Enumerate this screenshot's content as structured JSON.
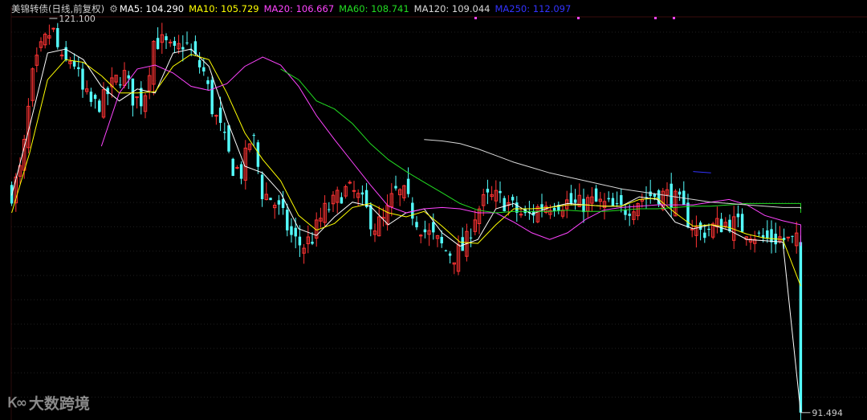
{
  "header": {
    "title": "美锦转债(日线,前复权)",
    "gear_icon": "gear-icon",
    "indicators": [
      {
        "label": "MA5: 104.290",
        "color": "#ffffff"
      },
      {
        "label": "MA10: 105.729",
        "color": "#ffff00"
      },
      {
        "label": "MA20: 106.667",
        "color": "#ff44ff"
      },
      {
        "label": "MA60: 108.741",
        "color": "#22dd22"
      },
      {
        "label": "MA120: 109.044",
        "color": "#d8d8d8"
      },
      {
        "label": "MA250: 112.097",
        "color": "#3333ff"
      }
    ]
  },
  "watermark": {
    "icon": "kuo-logo-icon",
    "text": "大数跨境"
  },
  "chart_data": {
    "type": "candlestick",
    "ylim": [
      91,
      122
    ],
    "x_count": 190,
    "max_label": "121.100",
    "min_label": "91.494",
    "close_path": [
      [
        0,
        108.0
      ],
      [
        6,
        110.0
      ],
      [
        12,
        116.5
      ],
      [
        18,
        119.0
      ],
      [
        24,
        120.3
      ],
      [
        30,
        117.5
      ],
      [
        36,
        118.2
      ],
      [
        42,
        115.5
      ],
      [
        48,
        114.5
      ],
      [
        54,
        114.9
      ],
      [
        60,
        116.2
      ],
      [
        66,
        117.0
      ],
      [
        72,
        115.0
      ],
      [
        78,
        115.0
      ],
      [
        84,
        119.5
      ],
      [
        90,
        119.2
      ],
      [
        96,
        118.4
      ],
      [
        102,
        119.4
      ],
      [
        108,
        118.1
      ],
      [
        114,
        116.9
      ],
      [
        118,
        114.5
      ],
      [
        124,
        112.5
      ],
      [
        130,
        110.0
      ],
      [
        136,
        109.5
      ],
      [
        142,
        112.6
      ],
      [
        148,
        108.0
      ],
      [
        154,
        107.5
      ],
      [
        160,
        106.2
      ],
      [
        166,
        104.5
      ],
      [
        172,
        104.0
      ],
      [
        178,
        104.7
      ],
      [
        184,
        106.5
      ],
      [
        190,
        107.2
      ],
      [
        196,
        108.2
      ],
      [
        202,
        108.0
      ],
      [
        208,
        107.0
      ],
      [
        214,
        105.5
      ],
      [
        220,
        105.9
      ],
      [
        226,
        108.0
      ],
      [
        232,
        107.8
      ],
      [
        238,
        106.2
      ],
      [
        244,
        105.1
      ],
      [
        250,
        104.5
      ],
      [
        256,
        103.7
      ],
      [
        262,
        103.3
      ],
      [
        268,
        104.0
      ],
      [
        274,
        106.5
      ],
      [
        280,
        107.5
      ],
      [
        286,
        107.6
      ],
      [
        292,
        107.3
      ],
      [
        298,
        106.6
      ],
      [
        304,
        106.1
      ],
      [
        310,
        106.8
      ],
      [
        316,
        107.2
      ],
      [
        322,
        107.3
      ],
      [
        328,
        107.3
      ],
      [
        334,
        107.0
      ],
      [
        340,
        107.3
      ],
      [
        346,
        107.2
      ],
      [
        352,
        107.0
      ],
      [
        358,
        106.6
      ],
      [
        364,
        106.9
      ],
      [
        370,
        107.5
      ],
      [
        376,
        107.8
      ],
      [
        382,
        107.9
      ],
      [
        388,
        107.8
      ],
      [
        394,
        107.2
      ],
      [
        400,
        105.9
      ],
      [
        406,
        105.0
      ],
      [
        412,
        105.3
      ],
      [
        418,
        105.6
      ],
      [
        424,
        105.8
      ],
      [
        430,
        105.5
      ],
      [
        436,
        105.2
      ],
      [
        442,
        104.6
      ],
      [
        448,
        104.5
      ],
      [
        454,
        104.6
      ],
      [
        460,
        104.3
      ],
      [
        464,
        104.3
      ],
      [
        466,
        91.494
      ]
    ],
    "ma_lines": [
      {
        "name": "MA5",
        "color": "#ffffff",
        "start": 0,
        "values": [
          107.8,
          113.0,
          118.5,
          118.8,
          118.0,
          116.0,
          114.9,
          115.8,
          115.5,
          118.5,
          118.8,
          117.5,
          113.5,
          110.0,
          109.5,
          108.0,
          105.3,
          104.8,
          106.2,
          107.3,
          107.0,
          105.6,
          106.5,
          106.8,
          105.0,
          104.0,
          104.5,
          106.8,
          107.2,
          106.4,
          106.9,
          107.2,
          107.1,
          107.0,
          107.0,
          107.7,
          107.5,
          105.8,
          105.3,
          105.6,
          105.2,
          104.5,
          104.4,
          104.3,
          91.5
        ]
      },
      {
        "name": "MA10",
        "color": "#ffff00",
        "start": 0,
        "values": [
          106.5,
          111.0,
          116.5,
          118.0,
          117.8,
          116.8,
          115.5,
          115.5,
          115.6,
          117.5,
          118.4,
          118.0,
          115.5,
          112.5,
          110.5,
          108.9,
          106.3,
          105.2,
          105.7,
          106.9,
          107.2,
          106.5,
          106.2,
          106.6,
          105.5,
          104.3,
          104.2,
          105.6,
          106.8,
          106.8,
          106.9,
          107.1,
          107.1,
          107.0,
          107.0,
          107.5,
          107.6,
          106.5,
          105.5,
          105.6,
          105.4,
          104.9,
          104.6,
          104.5,
          101.0
        ]
      },
      {
        "name": "MA20",
        "color": "#ff44ff",
        "start": 5,
        "values": [
          111.5,
          115.5,
          117.3,
          117.6,
          117.0,
          116.0,
          115.7,
          116.2,
          117.5,
          118.2,
          117.6,
          116.0,
          113.8,
          112.0,
          110.3,
          108.6,
          107.0,
          106.5,
          106.8,
          106.9,
          106.8,
          106.5,
          106.5,
          105.8,
          105.0,
          104.5,
          105.0,
          106.0,
          106.7,
          106.9,
          107.0,
          107.1,
          107.1,
          107.1,
          107.3,
          107.5,
          107.1,
          106.3,
          105.9,
          105.6,
          105.3,
          105.0,
          104.9,
          104.0
        ]
      },
      {
        "name": "MA60",
        "color": "#22dd22",
        "start": 15,
        "values": [
          117.3,
          116.5,
          114.9,
          114.3,
          113.2,
          111.7,
          110.5,
          109.6,
          108.8,
          108.0,
          107.2,
          106.7,
          106.5,
          106.6,
          106.6,
          106.6,
          106.7,
          106.6,
          106.6,
          106.7,
          106.8,
          106.8,
          106.9,
          107.0,
          107.0,
          107.1,
          107.2,
          107.2,
          107.2,
          107.2,
          106.8,
          106.5
        ]
      },
      {
        "name": "MA120",
        "color": "#d8d8d8",
        "start": 23,
        "values": [
          112.0,
          111.9,
          111.7,
          111.3,
          110.8,
          110.3,
          109.9,
          109.5,
          109.2,
          108.9,
          108.6,
          108.3,
          108.1,
          107.9,
          107.7,
          107.5,
          107.3,
          107.2,
          107.1,
          107.0,
          106.9,
          106.9,
          106.9,
          106.8
        ]
      },
      {
        "name": "MA250",
        "color": "#3333ff",
        "start": 38,
        "values": [
          109.6,
          109.5
        ]
      }
    ],
    "up_color": "#ff3333",
    "down_color": "#54ffff"
  }
}
